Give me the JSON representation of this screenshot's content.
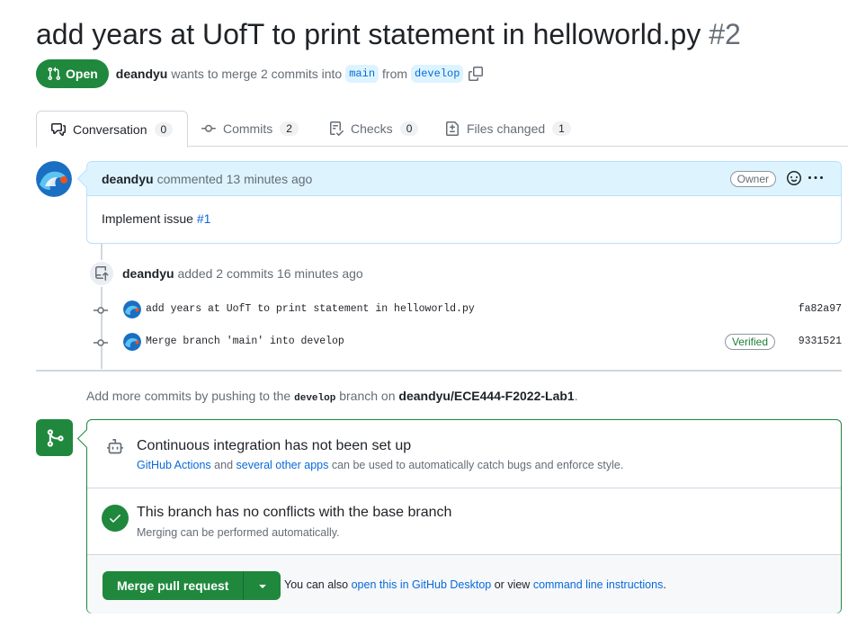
{
  "pr": {
    "title": "add years at UofT to print statement in helloworld.py",
    "number": "#2",
    "state": "Open",
    "author": "deandyu",
    "merge_text": "wants to merge 2 commits into",
    "base_branch": "main",
    "from_text": "from",
    "head_branch": "develop"
  },
  "tabs": [
    {
      "label": "Conversation",
      "count": "0"
    },
    {
      "label": "Commits",
      "count": "2"
    },
    {
      "label": "Checks",
      "count": "0"
    },
    {
      "label": "Files changed",
      "count": "1"
    }
  ],
  "comment": {
    "author": "deandyu",
    "action": "commented 13 minutes ago",
    "badge": "Owner",
    "body_text": "Implement issue",
    "body_link": "#1"
  },
  "commits_event": {
    "author": "deandyu",
    "action": "added 2 commits 16 minutes ago",
    "commits": [
      {
        "message": "add years at UofT to print statement in helloworld.py",
        "sha": "fa82a97",
        "verified": ""
      },
      {
        "message": "Merge branch 'main' into develop",
        "sha": "9331521",
        "verified": "Verified"
      }
    ]
  },
  "push_hint": {
    "prefix": "Add more commits by pushing to the",
    "branch": "develop",
    "middle": "branch on",
    "repo": "deandyu/ECE444-F2022-Lab1",
    "suffix": "."
  },
  "merge_box": {
    "ci_title": "Continuous integration has not been set up",
    "ci_link1": "GitHub Actions",
    "ci_and": "and",
    "ci_link2": "several other apps",
    "ci_suffix": "can be used to automatically catch bugs and enforce style.",
    "conflict_title": "This branch has no conflicts with the base branch",
    "conflict_sub": "Merging can be performed automatically.",
    "merge_button": "Merge pull request",
    "also_prefix": "You can also",
    "also_link1": "open this in GitHub Desktop",
    "also_or": "or view",
    "also_link2": "command line instructions",
    "also_suffix": "."
  },
  "colors": {
    "accent_green": "#1f883d",
    "link_blue": "#0969da",
    "header_blue": "#ddf4ff"
  }
}
